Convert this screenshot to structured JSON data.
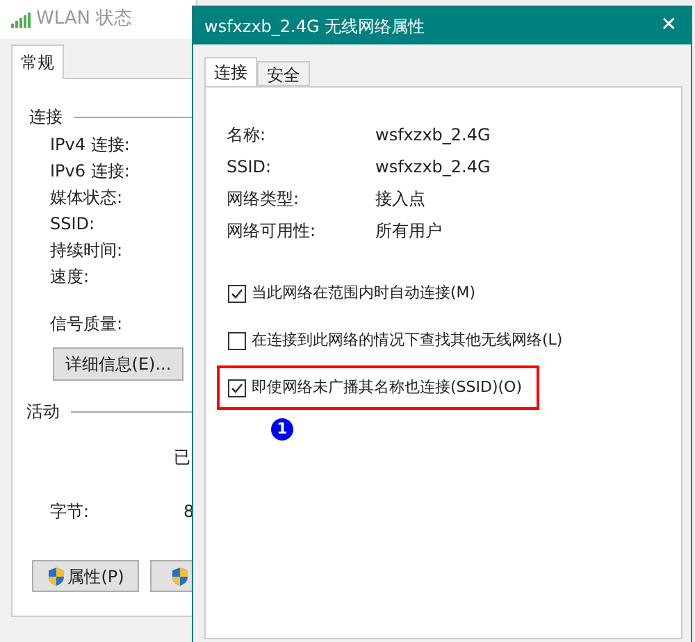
{
  "background_window": {
    "title": "WLAN 状态",
    "tabs": [
      {
        "label": "常规",
        "selected": true
      }
    ],
    "connection_section": "连接",
    "fields": [
      "IPv4 连接:",
      "IPv6 连接:",
      "媒体状态:",
      "SSID:",
      "持续时间:",
      "速度:"
    ],
    "signal_label": "信号质量:",
    "details_button": "详细信息(E)...",
    "activity_section": "活动",
    "sent_header": "已",
    "bytes_label": "字节:",
    "bytes_value": "8",
    "properties_button": "属性(P)"
  },
  "dialog": {
    "title": "wsfxzxb_2.4G 无线网络属性",
    "close": "✕",
    "tabs": [
      {
        "label": "连接",
        "selected": true
      },
      {
        "label": "安全",
        "selected": false
      }
    ],
    "properties": [
      {
        "label": "名称:",
        "value": "wsfxzxb_2.4G"
      },
      {
        "label": "SSID:",
        "value": "wsfxzxb_2.4G"
      },
      {
        "label": "网络类型:",
        "value": "接入点"
      },
      {
        "label": "网络可用性:",
        "value": "所有用户"
      }
    ],
    "options": [
      {
        "label": "当此网络在范围内时自动连接(M)",
        "checked": true,
        "highlighted": false
      },
      {
        "label": "在连接到此网络的情况下查找其他无线网络(L)",
        "checked": false,
        "highlighted": false
      },
      {
        "label": "即使网络未广播其名称也连接(SSID)(O)",
        "checked": true,
        "highlighted": true,
        "badge": "1"
      }
    ]
  }
}
